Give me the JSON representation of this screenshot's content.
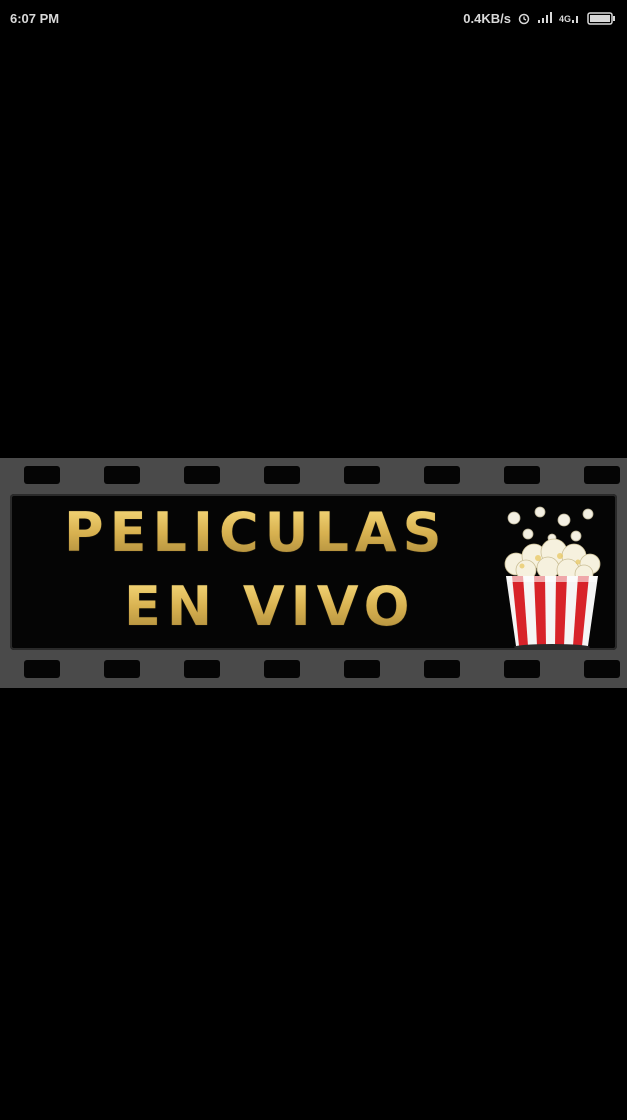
{
  "status_bar": {
    "time": "6:07 PM",
    "network_speed": "0.4KB/s"
  },
  "splash": {
    "title_line_1": "PELICULAS",
    "title_line_2": "EN VIVO"
  },
  "colors": {
    "background": "#000000",
    "film_strip": "#4a4a4a",
    "title_gold": "#c9a64a",
    "popcorn_red": "#d8232a"
  },
  "icons": [
    "alarm-icon",
    "signal-icon",
    "wifi-icon",
    "battery-icon",
    "popcorn-icon"
  ]
}
